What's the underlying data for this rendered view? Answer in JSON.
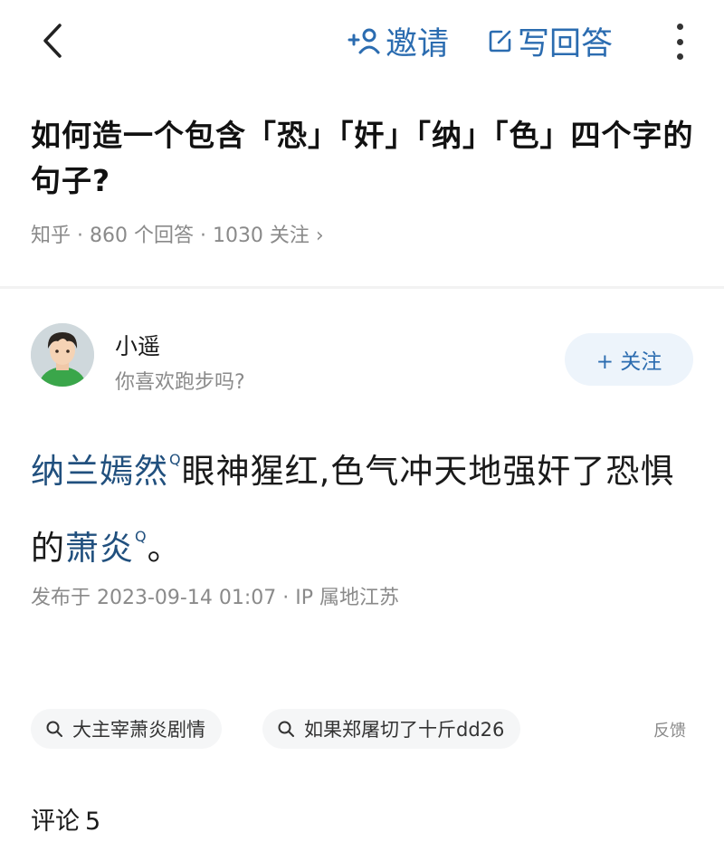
{
  "header": {
    "invite_label": "邀请",
    "write_answer_label": "写回答",
    "icons": [
      "back-icon",
      "invite-icon",
      "edit-icon",
      "more-icon"
    ]
  },
  "question": {
    "title": "如何造一个包含「恐」「奸」「纳」「色」四个字的句子?",
    "meta": "知乎 · 860 个回答 · 1030 关注 ›"
  },
  "answer": {
    "author_name": "小遥",
    "author_bio": "你喜欢跑步吗?",
    "follow_label": "+ 关注",
    "content": {
      "kw1": "纳兰嫣然",
      "part1": "眼神猩红,色气冲天地强奸了恐惧的",
      "kw2": "萧炎",
      "part2": "。",
      "search_mark": "Q"
    },
    "publish_info": "发布于 2023-09-14 01:07 · IP 属地江苏"
  },
  "related": {
    "tags": [
      "大主宰萧炎剧情",
      "如果郑屠切了十斤dd26"
    ],
    "feedback_label": "反馈"
  },
  "comments": {
    "label": "评论",
    "count": "5"
  },
  "colors": {
    "accent": "#2b6cb0",
    "keyword": "#21507e",
    "muted": "#8a8a8a"
  }
}
